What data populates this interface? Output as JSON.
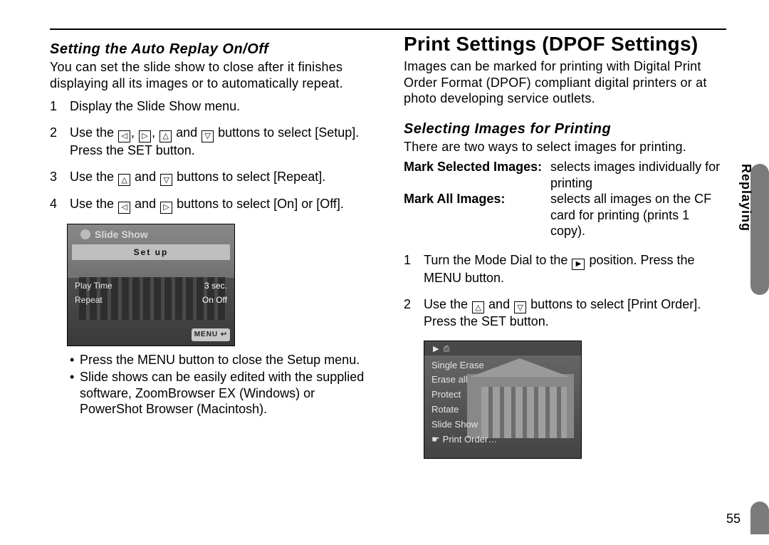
{
  "page_number": "55",
  "thumb_label": "Replaying",
  "left": {
    "heading": "Setting the Auto Replay On/Off",
    "intro": "You can set the slide show to close after it finishes displaying all its images or to automatically repeat.",
    "steps": {
      "s1": "Display the Slide Show menu.",
      "s2a": "Use the ",
      "s2b": " buttons to select [Setup]. Press the SET button.",
      "s3a": "Use the ",
      "s3b": " buttons to select [Repeat].",
      "s4a": "Use the ",
      "s4b": " buttons to select [On] or [Off]."
    },
    "and": " and ",
    "commaspace": ", ",
    "bullets": {
      "b1": "Press the MENU button to close the Setup menu.",
      "b2": "Slide shows can be easily edited with the supplied software, ZoomBrowser EX (Windows) or PowerShot Browser (Macintosh)."
    },
    "screenshot": {
      "title": "Slide Show",
      "row_setup": "Set up",
      "row_play_l": "Play Time",
      "row_play_r": "3 sec.",
      "row_rep_l": "Repeat",
      "row_rep_r": "On Off",
      "menu_btn": "MENU ↩"
    }
  },
  "right": {
    "title": "Print Settings (DPOF Settings)",
    "intro": "Images can be marked for printing with Digital Print Order Format (DPOF) compliant digital printers or at photo developing service outlets.",
    "sub": "Selecting Images for Printing",
    "sub_intro": "There are two ways to select images for printing.",
    "def1_label": "Mark Selected Images:",
    "def1_text": "selects images individually for printing",
    "def2_label": "Mark All Images:",
    "def2_text": "selects all images on the CF card for printing (prints 1 copy).",
    "steps": {
      "s1a": "Turn the Mode Dial to the ",
      "s1b": " position. Press the MENU button.",
      "s2a": "Use the ",
      "s2b": " buttons to select [Print Order]. Press the SET button."
    },
    "and": " and ",
    "screenshot": {
      "items": {
        "i1": "Single Erase",
        "i2": "Erase all",
        "i3": "Protect",
        "i4": "Rotate",
        "i5": "Slide Show",
        "i6": "Print Order…"
      },
      "hand": "☛"
    }
  }
}
